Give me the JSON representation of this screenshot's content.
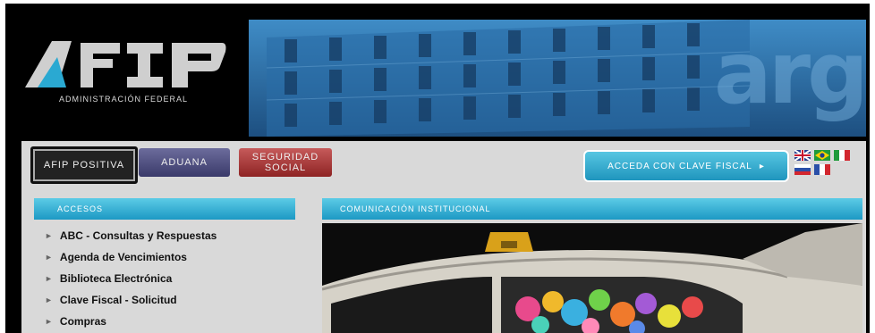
{
  "header": {
    "logo_text": "AFIP",
    "logo_caption": "Administración Federal",
    "banner_text": "arg"
  },
  "tabs": [
    {
      "label": "AFIP Positiva"
    },
    {
      "label": "Aduana"
    },
    {
      "label": "Seguridad Social"
    }
  ],
  "clave_fiscal_button": {
    "label": "Acceda con Clave Fiscal",
    "arrow": "▸"
  },
  "languages": [
    "English",
    "Português",
    "Italiano",
    "Русский",
    "Français"
  ],
  "sidebar": {
    "title": "Accesos",
    "items": [
      {
        "label": "ABC - Consultas y Respuestas"
      },
      {
        "label": "Agenda de Vencimientos"
      },
      {
        "label": "Biblioteca Electrónica"
      },
      {
        "label": "Clave Fiscal - Solicitud"
      },
      {
        "label": "Compras"
      }
    ]
  },
  "content": {
    "title": "Comunicación Institucional"
  },
  "colors": {
    "accent": "#2aa9d2",
    "page_bg": "#000000",
    "panel_bg": "#d9d9d9"
  }
}
